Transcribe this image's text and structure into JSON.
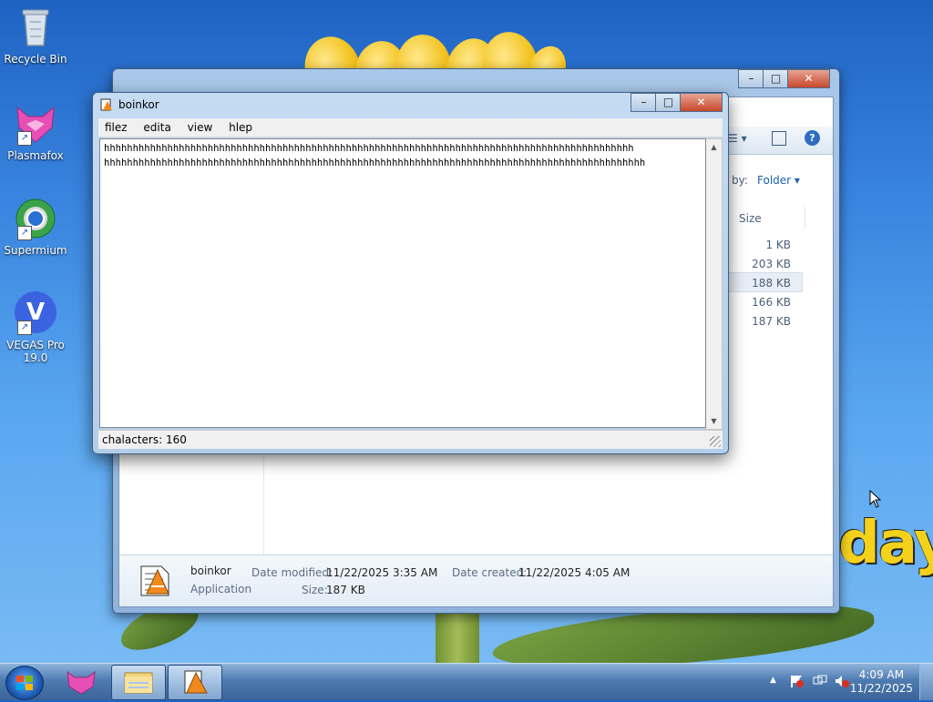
{
  "desktop": {
    "icons": [
      {
        "label": "Recycle Bin",
        "icon": "recycle-bin-icon"
      },
      {
        "label": "Plasmafox",
        "icon": "plasmafox-icon"
      },
      {
        "label": "Supermium",
        "icon": "supermium-icon"
      },
      {
        "label": "VEGAS Pro\n19.0",
        "icon": "vegas-pro-icon",
        "glyph": "V"
      }
    ],
    "wallpaper_text": "day"
  },
  "explorer": {
    "window_controls": {
      "minimize": "–",
      "maximize": "□",
      "close": "✕"
    },
    "arrange_by_label": "by:",
    "arrange_value": "Folder ▾",
    "column_size": "Size",
    "sizes": [
      "1 KB",
      "203 KB",
      "188 KB",
      "166 KB",
      "187 KB"
    ],
    "details": {
      "name": "boinkor",
      "type": "Application",
      "modified_label": "Date modified:",
      "modified_value": "11/22/2025 3:35 AM",
      "created_label": "Date created:",
      "created_value": "11/22/2025 4:05 AM",
      "size_label": "Size:",
      "size_value": "187 KB"
    }
  },
  "notepad": {
    "title": "boinkor",
    "window_controls": {
      "minimize": "–",
      "maximize": "□",
      "close": "✕"
    },
    "menu": [
      "filez",
      "edita",
      "view",
      "hlep"
    ],
    "content": "hhhhhhhhhhhhhhhhhhhhhhhhhhhhhhhhhhhhhhhhhhhhhhhhhhhhhhhhhhhhhhhhhhhhhhhhhhhhhhhhhhhhhhhhhhhh\nhhhhhhhhhhhhhhhhhhhhhhhhhhhhhhhhhhhhhhhhhhhhhhhhhhhhhhhhhhhhhhhhhhhhhhhhhhhhhhhhhhhhhhhhhhhhhh",
    "status": "chalacters: 160"
  },
  "taskbar": {
    "clock_time": "4:09 AM",
    "clock_date": "11/22/2025",
    "tray_expand": "▲"
  }
}
